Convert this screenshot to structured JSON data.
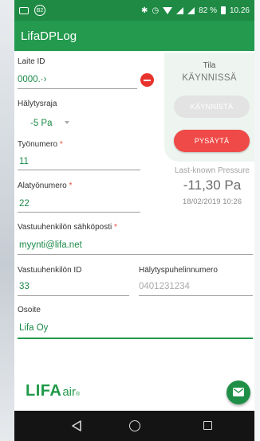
{
  "status_bar": {
    "left_badge": "B2",
    "battery_text": "82 %",
    "time": "10.26"
  },
  "app": {
    "title": "LifaDPLog"
  },
  "form": {
    "device_id": {
      "label": "Laite ID",
      "value": "0000.·›"
    },
    "alarm_limit": {
      "label": "Hälytysraja",
      "value": "-5 Pa"
    },
    "work_number": {
      "label": "Työnumero",
      "required_mark": "*",
      "value": "11"
    },
    "sub_work_number": {
      "label": "Alatyönumero",
      "required_mark": "*",
      "value": "22"
    },
    "contact_email": {
      "label": "Vastuuhenkilön sähköposti",
      "required_mark": "*",
      "value": "myynti@lifa.net"
    },
    "contact_id": {
      "label": "Vastuuhenkilön ID",
      "value": "33"
    },
    "alarm_phone": {
      "label": "Hälytyspuhelinnumero",
      "placeholder": "0401231234"
    },
    "address": {
      "label": "Osoite",
      "value": "Lifa Oy"
    }
  },
  "status_panel": {
    "label": "Tila",
    "state": "KÄYNNISSÄ",
    "start_button": "KÄYNNISTÄ",
    "stop_button": "PYSÄYTÄ"
  },
  "pressure": {
    "label": "Last-known Pressure",
    "value": "-11,30 Pa",
    "timestamp": "18/02/2019 10:26"
  },
  "logo": {
    "brand": "LIFA",
    "suffix": "air",
    "mark": "®"
  },
  "colors": {
    "status_bar": "#1e8a44",
    "app_bar": "#239a4e",
    "accent_green": "#1b8a48",
    "stop_red": "#ef4a47",
    "remove_red": "#e8332c"
  }
}
